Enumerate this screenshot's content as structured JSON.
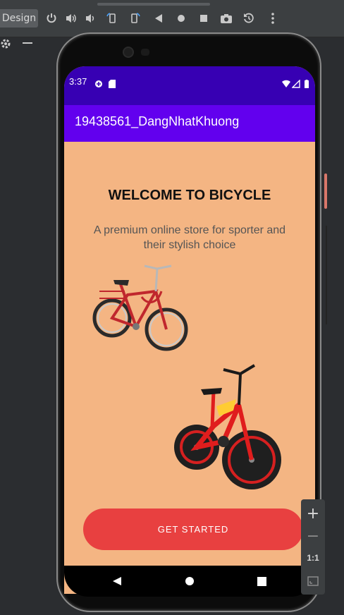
{
  "ide": {
    "design_tab": "Design",
    "tools": [
      "power-icon",
      "volume-up-icon",
      "volume-down-icon",
      "rotate-left-icon",
      "rotate-right-icon",
      "back-icon",
      "home-icon",
      "overview-icon",
      "camera-icon",
      "replay-icon",
      "more-icon"
    ],
    "zoom": {
      "plus": "+",
      "minus": "−",
      "one_to_one": "1:1"
    }
  },
  "device": {
    "status_time": "3:37",
    "app_title": "19438561_DangNhatKhuong"
  },
  "content": {
    "welcome": "WELCOME TO BICYCLE",
    "subtitle": "A premium online store for sporter and their stylish choice",
    "cta": "GET STARTED"
  },
  "colors": {
    "status_bar": "#3700b3",
    "app_bar": "#6200ee",
    "background": "#f4b583",
    "cta": "#e84040"
  }
}
